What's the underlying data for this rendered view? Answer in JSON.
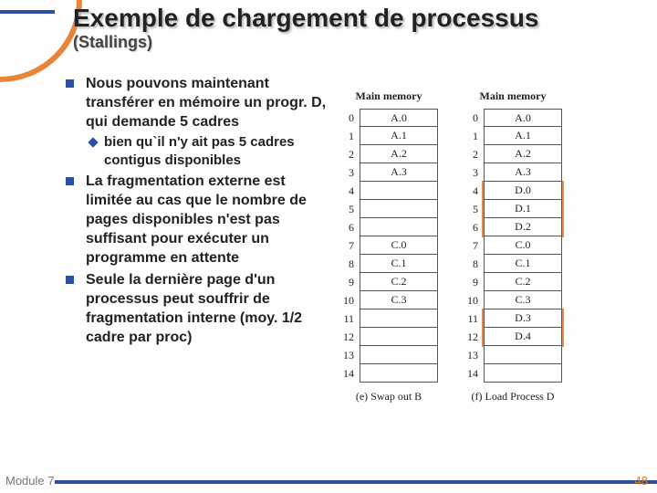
{
  "title": "Exemple de chargement de processus",
  "subtitle": "(Stallings)",
  "bullets": {
    "b1": "Nous pouvons maintenant transférer en mémoire un progr. D, qui demande 5 cadres",
    "b1_sub": "bien qu`il n'y ait pas  5 cadres contigus disponibles",
    "b2": "La fragmentation externe est limitée au cas que le nombre de pages disponibles n'est pas suffisant pour exécuter un programme en attente",
    "b3": "Seule la dernière page d'un processus peut souffrir de fragmentation interne (moy. 1/2 cadre par proc)"
  },
  "figLeft": {
    "title": "Main memory",
    "caption": "(e) Swap out B",
    "rows": [
      "0",
      "1",
      "2",
      "3",
      "4",
      "5",
      "6",
      "7",
      "8",
      "9",
      "10",
      "11",
      "12",
      "13",
      "14"
    ],
    "cells": [
      "A.0",
      "A.1",
      "A.2",
      "A.3",
      "",
      "",
      "",
      "C.0",
      "C.1",
      "C.2",
      "C.3",
      "",
      "",
      "",
      ""
    ]
  },
  "figRight": {
    "title": "Main memory",
    "caption": "(f) Load Process D",
    "rows": [
      "0",
      "1",
      "2",
      "3",
      "4",
      "5",
      "6",
      "7",
      "8",
      "9",
      "10",
      "11",
      "12",
      "13",
      "14"
    ],
    "cells": [
      "A.0",
      "A.1",
      "A.2",
      "A.3",
      "D.0",
      "D.1",
      "D.2",
      "C.0",
      "C.1",
      "C.2",
      "C.3",
      "D.3",
      "D.4",
      "",
      ""
    ]
  },
  "footer": {
    "left": "Module 7",
    "right": "48"
  }
}
